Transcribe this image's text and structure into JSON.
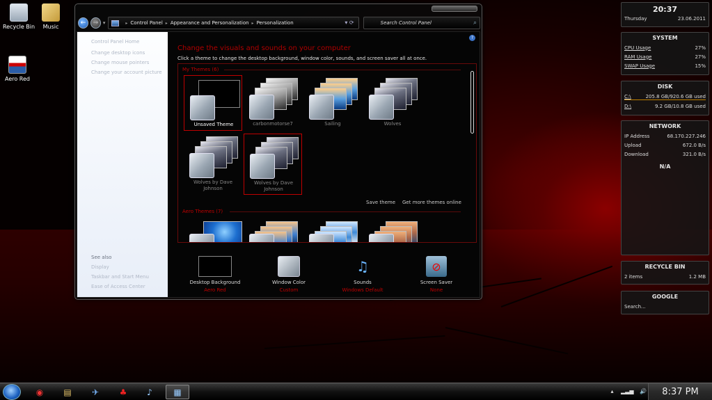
{
  "desktop": {
    "icons": [
      {
        "label": "Recycle Bin"
      },
      {
        "label": "Music"
      },
      {
        "label": "Aero Red"
      }
    ]
  },
  "window": {
    "breadcrumbs": [
      "Control Panel",
      "Appearance and Personalization",
      "Personalization"
    ],
    "search_placeholder": "Search Control Panel",
    "sidebar": {
      "items": [
        "Control Panel Home",
        "Change desktop icons",
        "Change mouse pointers",
        "Change your account picture"
      ],
      "see_also_heading": "See also",
      "see_also": [
        "Display",
        "Taskbar and Start Menu",
        "Ease of Access Center"
      ]
    },
    "title": "Change the visuals and sounds on your computer",
    "subtitle": "Click a theme to change the desktop background, window color, sounds, and screen saver all at once.",
    "my_themes_heading": "My Themes (6)",
    "my_themes": [
      {
        "label": "Unsaved Theme"
      },
      {
        "label": "carbonmotorse7"
      },
      {
        "label": "Sailing"
      },
      {
        "label": "Wolves"
      },
      {
        "label": "Wolves by Dave Johnson"
      },
      {
        "label": "Wolves by Dave Johnson"
      }
    ],
    "save_theme": "Save theme",
    "get_more": "Get more themes online",
    "aero_themes_heading": "Aero Themes (7)",
    "bottom": [
      {
        "label": "Desktop Background",
        "value": "Aero Red"
      },
      {
        "label": "Window Color",
        "value": "Custom"
      },
      {
        "label": "Sounds",
        "value": "Windows Default"
      },
      {
        "label": "Screen Saver",
        "value": "None"
      }
    ]
  },
  "gadgets": {
    "clock": {
      "time": "20:37",
      "day": "Thursday",
      "date": "23.06.2011"
    },
    "system": {
      "title": "SYSTEM",
      "rows": [
        {
          "label": "CPU Usage",
          "value": "27%"
        },
        {
          "label": "RAM Usage",
          "value": "27%"
        },
        {
          "label": "SWAP Usage",
          "value": "15%"
        }
      ]
    },
    "disk": {
      "title": "DISK",
      "rows": [
        {
          "label": "C:\\",
          "value": "205.8 GB/920.6 GB used"
        },
        {
          "label": "D:\\",
          "value": "9.2 GB/10.8 GB used"
        }
      ]
    },
    "network": {
      "title": "NETWORK",
      "rows": [
        {
          "label": "IP Address",
          "value": "68.170.227.246"
        },
        {
          "label": "Upload",
          "value": "672.0 B/s"
        },
        {
          "label": "Download",
          "value": "321.0 B/s"
        }
      ],
      "extra": "N/A"
    },
    "recycle": {
      "title": "RECYCLE BIN",
      "items": "2 items",
      "size": "1.2 MB"
    },
    "google": {
      "title": "GOOGLE",
      "placeholder": "Search..."
    }
  },
  "taskbar": {
    "clock": "8:37 PM"
  }
}
